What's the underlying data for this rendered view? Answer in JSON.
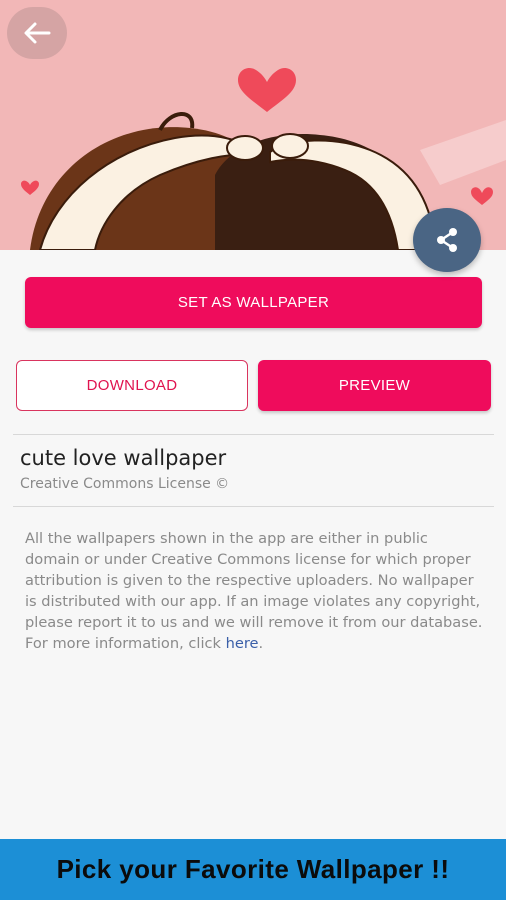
{
  "wallpaper": {
    "title": "cute love wallpaper",
    "license": "Creative Commons License ©"
  },
  "actions": {
    "set_wallpaper_label": "SET AS WALLPAPER",
    "download_label": "DOWNLOAD",
    "preview_label": "PREVIEW"
  },
  "disclaimer": {
    "text": "All the wallpapers shown in the app are either in public domain or under Creative Commons license for which proper attribution is given to the respective uploaders. No wallpaper is distributed with our app. If an image violates any copyright, please report it to us and we will remove it from our database. For more information, click ",
    "link_text": "here",
    "trailing": "."
  },
  "footer": {
    "banner_text": "Pick your Favorite Wallpaper !!"
  },
  "icons": {
    "back": "arrow-left-icon",
    "share": "share-icon"
  },
  "colors": {
    "accent": "#ef0c5c",
    "share_button": "#4a6584",
    "banner": "#1c8fd6",
    "hero_background": "#f2b7b7"
  }
}
